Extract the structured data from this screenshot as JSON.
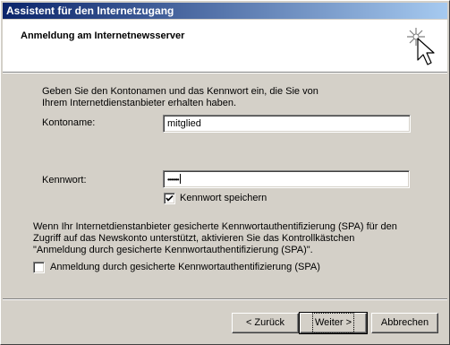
{
  "window": {
    "title": "Assistent für den Internetzugang"
  },
  "header": {
    "heading": "Anmeldung am Internetnewsserver",
    "graphic_icon": "wizard-sparkle-cursor-icon"
  },
  "intro": {
    "text": "Geben Sie den Kontonamen und das Kennwort ein, die Sie von Ihrem Internetdienstanbieter erhalten haben."
  },
  "account": {
    "label": "Kontoname:",
    "value": "mitglied"
  },
  "password": {
    "label": "Kennwort:",
    "value": "•••••••"
  },
  "remember_password": {
    "label": "Kennwort speichern",
    "checked": true
  },
  "spa": {
    "text": "Wenn Ihr Internetdienstanbieter gesicherte Kennwortauthentifizierung (SPA) für den Zugriff auf das Newskonto unterstützt, aktivieren Sie das Kontrollkästchen \"Anmeldung durch gesicherte Kennwortauthentifizierung (SPA)\".",
    "checkbox_label": "Anmeldung durch gesicherte Kennwortauthentifizierung (SPA)",
    "checked": false
  },
  "buttons": {
    "back": "< Zurück",
    "next": "Weiter >",
    "cancel": "Abbrechen"
  }
}
